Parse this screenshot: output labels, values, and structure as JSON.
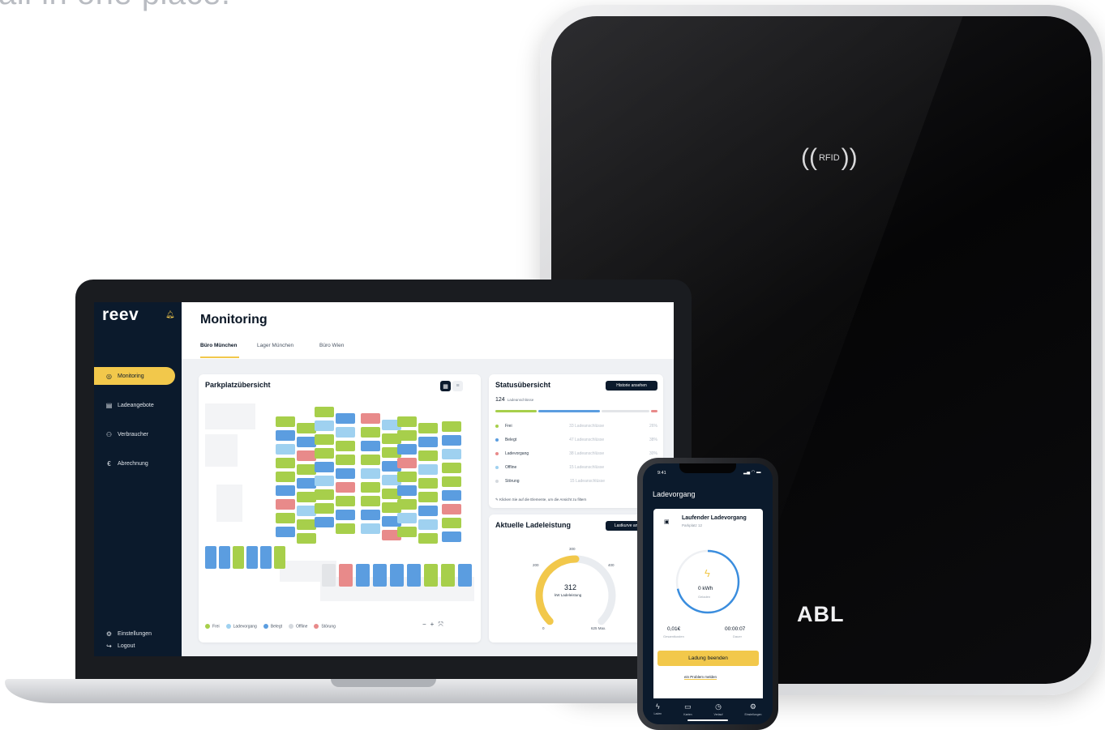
{
  "headline": "all in one place.",
  "wallbox": {
    "rfid_label": "RFID",
    "brand": "ABL"
  },
  "app": {
    "logo": "reev",
    "sidebar": {
      "items": [
        {
          "label": "Monitoring",
          "icon": "monitor-icon",
          "active": true
        },
        {
          "label": "Ladeangebote",
          "icon": "document-icon",
          "active": false
        },
        {
          "label": "Verbraucher",
          "icon": "users-icon",
          "active": false
        },
        {
          "label": "Abrechnung",
          "icon": "euro-icon",
          "active": false
        }
      ],
      "settings": "Einstellungen",
      "logout": "Logout"
    },
    "title": "Monitoring",
    "tabs": [
      "Büro München",
      "Lager München",
      "Büro Wien"
    ],
    "parking": {
      "title": "Parkplatzübersicht",
      "legend": [
        "Frei",
        "Ladevorgang",
        "Belegt",
        "Offline",
        "Störung"
      ],
      "zoom": [
        "−",
        "+",
        "⤧"
      ]
    },
    "status": {
      "title": "Statusübersicht",
      "history_button": "Historie ansehen",
      "total": "124",
      "total_label": "Ladeanschlüsse",
      "rows": [
        {
          "name": "Frei",
          "count": "33 Ladeanschlüsse",
          "pct": "26%",
          "color": "#a7cf4b"
        },
        {
          "name": "Belegt",
          "count": "47 Ladeanschlüsse",
          "pct": "38%",
          "color": "#5b9de0"
        },
        {
          "name": "Ladevorgang",
          "count": "38 Ladeanschlüsse",
          "pct": "30%",
          "color": "#e88a8a"
        },
        {
          "name": "Offline",
          "count": "15 Ladeanschlüsse",
          "pct": "12%",
          "color": "#9fd1f0"
        },
        {
          "name": "Störung",
          "count": "15 Ladeanschlüsse",
          "pct": "4%",
          "color": "#d5d9de"
        }
      ],
      "hint": "Klicken Sie auf die Elemente, um die Ansicht zu filtern"
    },
    "load": {
      "title": "Aktuelle Ladeleistung",
      "button": "Lastkurve ansehen",
      "value": "312",
      "unit": "kW Ladeleistung",
      "scale": [
        "0",
        "200",
        "300",
        "400",
        "625 Max."
      ],
      "fraction": 0.5
    }
  },
  "phone": {
    "time": "9:41",
    "title": "Ladevorgang",
    "session_title": "Laufender Ladevorgang",
    "session_sub": "Parkplatz 12",
    "energy": "0 kWh",
    "energy_label": "Geladen",
    "cost": "0,01€",
    "cost_label": "Gesamtkosten",
    "duration": "00:00:07",
    "duration_label": "Dauer",
    "stop_button": "Ladung beenden",
    "problem_link": "ein Problem melden",
    "tabs": [
      {
        "label": "Laden",
        "icon": "bolt-icon"
      },
      {
        "label": "Karten",
        "icon": "wallet-icon"
      },
      {
        "label": "Verlauf",
        "icon": "history-icon"
      },
      {
        "label": "Einstellungen",
        "icon": "gear-icon"
      }
    ],
    "colors": {
      "accent": "#f2c84b",
      "navy": "#0b1a2c",
      "ring": "#3a8dde"
    }
  }
}
